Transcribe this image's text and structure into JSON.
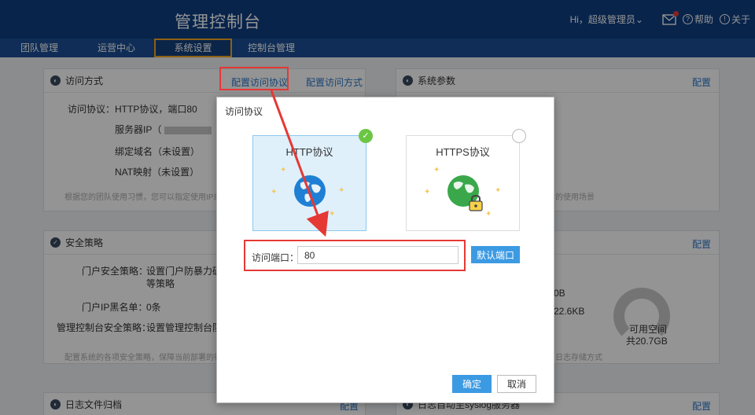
{
  "header": {
    "title": "管理控制台",
    "greeting": "Hi，超级管理员",
    "help_label": "帮助",
    "about_label": "关于",
    "colors": {
      "header_bg": "#0e3f82",
      "nav_bg": "#1a4f95",
      "active_border": "#f5a623"
    }
  },
  "nav": {
    "items": [
      {
        "label": "团队管理"
      },
      {
        "label": "运营中心"
      },
      {
        "label": "系统设置",
        "active": true
      },
      {
        "label": "控制台管理"
      }
    ]
  },
  "access_panel": {
    "title": "访问方式",
    "link_protocol": "配置访问协议",
    "link_method": "配置访问方式",
    "protocol_key": "访问协议：",
    "protocol_value": "HTTP协议，端口80",
    "server_ip": "服务器IP（",
    "bound_domain": "绑定域名（未设置）",
    "nat_map": "NAT映射（未设置）",
    "hint": "根据您的团队使用习惯，您可以指定使用IP或域名",
    "hint_right": "的使用场景"
  },
  "sysparam_panel": {
    "title": "系统参数",
    "link": "配置"
  },
  "security_panel": {
    "title": "安全策略",
    "link": "配置",
    "portal_key": "门户安全策略：",
    "portal_value": "设置门户防暴力破解",
    "portal_value2": "等策略",
    "blacklist_key": "门户IP黑名单：",
    "blacklist_value": "0条",
    "console_key": "管理控制台安全策略：",
    "console_value": "设置管理控制台防暴",
    "hint": "配置系统的各项安全策略，保障当前部署的行云",
    "hint_right": "日志存储方式"
  },
  "storage_panel": {
    "link": "配置",
    "used1": "0B",
    "used2": "22.6KB",
    "available_label": "可用空间",
    "available_total": "共20.7GB"
  },
  "log_panel": {
    "title": "日志文件归档",
    "link": "配置"
  },
  "syslog_panel": {
    "title": "日志自动至syslog服务器",
    "link": "配置"
  },
  "dialog": {
    "title": "访问协议",
    "http_label": "HTTP协议",
    "https_label": "HTTPS协议",
    "selected": "HTTP协议",
    "port_label": "访问端口：",
    "port_value": "80",
    "default_port_button": "默认端口",
    "confirm_button": "确定",
    "cancel_button": "取消"
  },
  "icons": {
    "mail": "mail-icon",
    "help": "help-icon",
    "about": "info-icon",
    "check": "check-icon",
    "globe": "globe-icon",
    "lock": "lock-icon"
  }
}
